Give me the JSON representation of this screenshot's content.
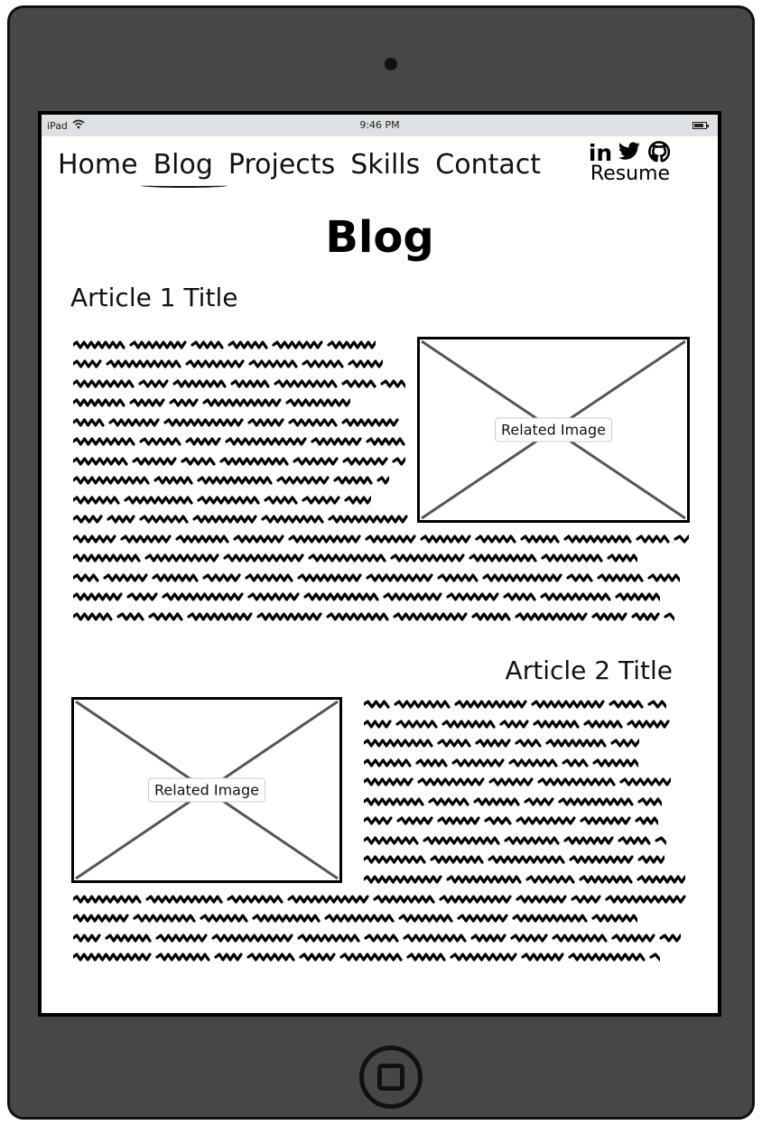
{
  "status_bar": {
    "device": "iPad",
    "time": "9:46 PM"
  },
  "nav": {
    "items": [
      {
        "label": "Home",
        "active": false
      },
      {
        "label": "Blog",
        "active": true
      },
      {
        "label": "Projects",
        "active": false
      },
      {
        "label": "Skills",
        "active": false
      },
      {
        "label": "Contact",
        "active": false
      }
    ]
  },
  "social": {
    "linkedin": "in",
    "icons": [
      "linkedin-icon",
      "twitter-icon",
      "github-icon"
    ],
    "resume": "Resume"
  },
  "page": {
    "title": "Blog"
  },
  "articles": [
    {
      "title": "Article 1 Title",
      "image_label": "Related Image"
    },
    {
      "title": "Article 2 Title",
      "image_label": "Related Image"
    }
  ]
}
